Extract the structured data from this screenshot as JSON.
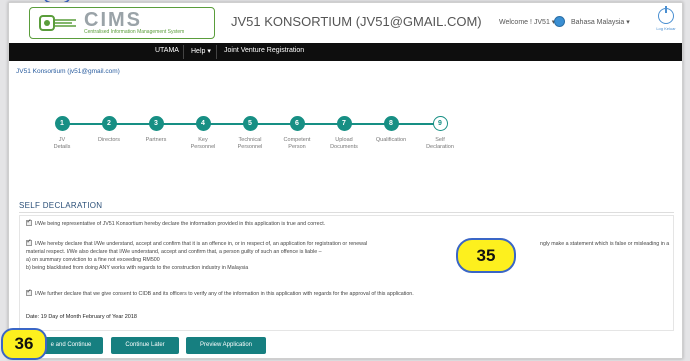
{
  "header": {
    "logo_word": "CIMS",
    "logo_sub": "Centralised Information Management System",
    "title": "JV51 KONSORTIUM (JV51@GMAIL.COM)",
    "welcome": "Welcome ! JV51 ▾",
    "language": "Bahasa Malaysia ▾",
    "logout_label": "Log Keluar"
  },
  "nav": {
    "items": [
      "UTAMA",
      "Help ▾",
      "Joint Venture Registration"
    ]
  },
  "company_link": "JV51 Konsortium (jv51@gmail.com)",
  "steps": [
    {
      "number": "1",
      "label1": "JV",
      "label2": "Details",
      "done": true
    },
    {
      "number": "2",
      "label1": "Directors",
      "label2": "",
      "done": true
    },
    {
      "number": "3",
      "label1": "Partners",
      "label2": "",
      "done": true
    },
    {
      "number": "4",
      "label1": "Key",
      "label2": "Personnel",
      "done": true
    },
    {
      "number": "5",
      "label1": "Technical",
      "label2": "Personnel",
      "done": true
    },
    {
      "number": "6",
      "label1": "Competent",
      "label2": "Person",
      "done": true
    },
    {
      "number": "7",
      "label1": "Upload",
      "label2": "Documents",
      "done": true
    },
    {
      "number": "8",
      "label1": "Qualification",
      "label2": "",
      "done": true
    },
    {
      "number": "9",
      "label1": "Self",
      "label2": "Declaration",
      "done": false
    }
  ],
  "self_declaration": {
    "title": "SELF DECLARATION",
    "decl1": "I/We being representative of JV51 Konsortium hereby declare the information provided in this application is true and correct.",
    "decl2a": "I/We hereby declare that I/We understand, accept and confirm that it is an offence in, or in respect of, an application for registration or renewal",
    "decl2b": "ngly make a statement which is false or misleading in a",
    "decl2c": "material respect. I/We also declare that I/We understand, accept and confirm that, a person guilty of such an offence is liable –",
    "decl2d": "a) on summary conviction to a fine not exceeding RM500",
    "decl2e": "b) being blacklisted from doing ANY works with regards to the construction industry in Malaysia",
    "decl3": "I/We further declare that we give consent to CIDB and its officers to verify any of the information in this application with regards for the approval of this application.",
    "date": "Date: 19 Day of Month February of Year 2018"
  },
  "buttons": {
    "save_continue": "e and Continue",
    "continue_later": "Continue Later",
    "preview": "Preview Application"
  },
  "callouts": {
    "c35": "35",
    "c36": "36"
  },
  "colors": {
    "accent": "#178f84",
    "nav_bg": "#0e0e0e",
    "callout_fill": "#fdf01e",
    "callout_border": "#3a66c6",
    "link": "#2a5d9f"
  }
}
